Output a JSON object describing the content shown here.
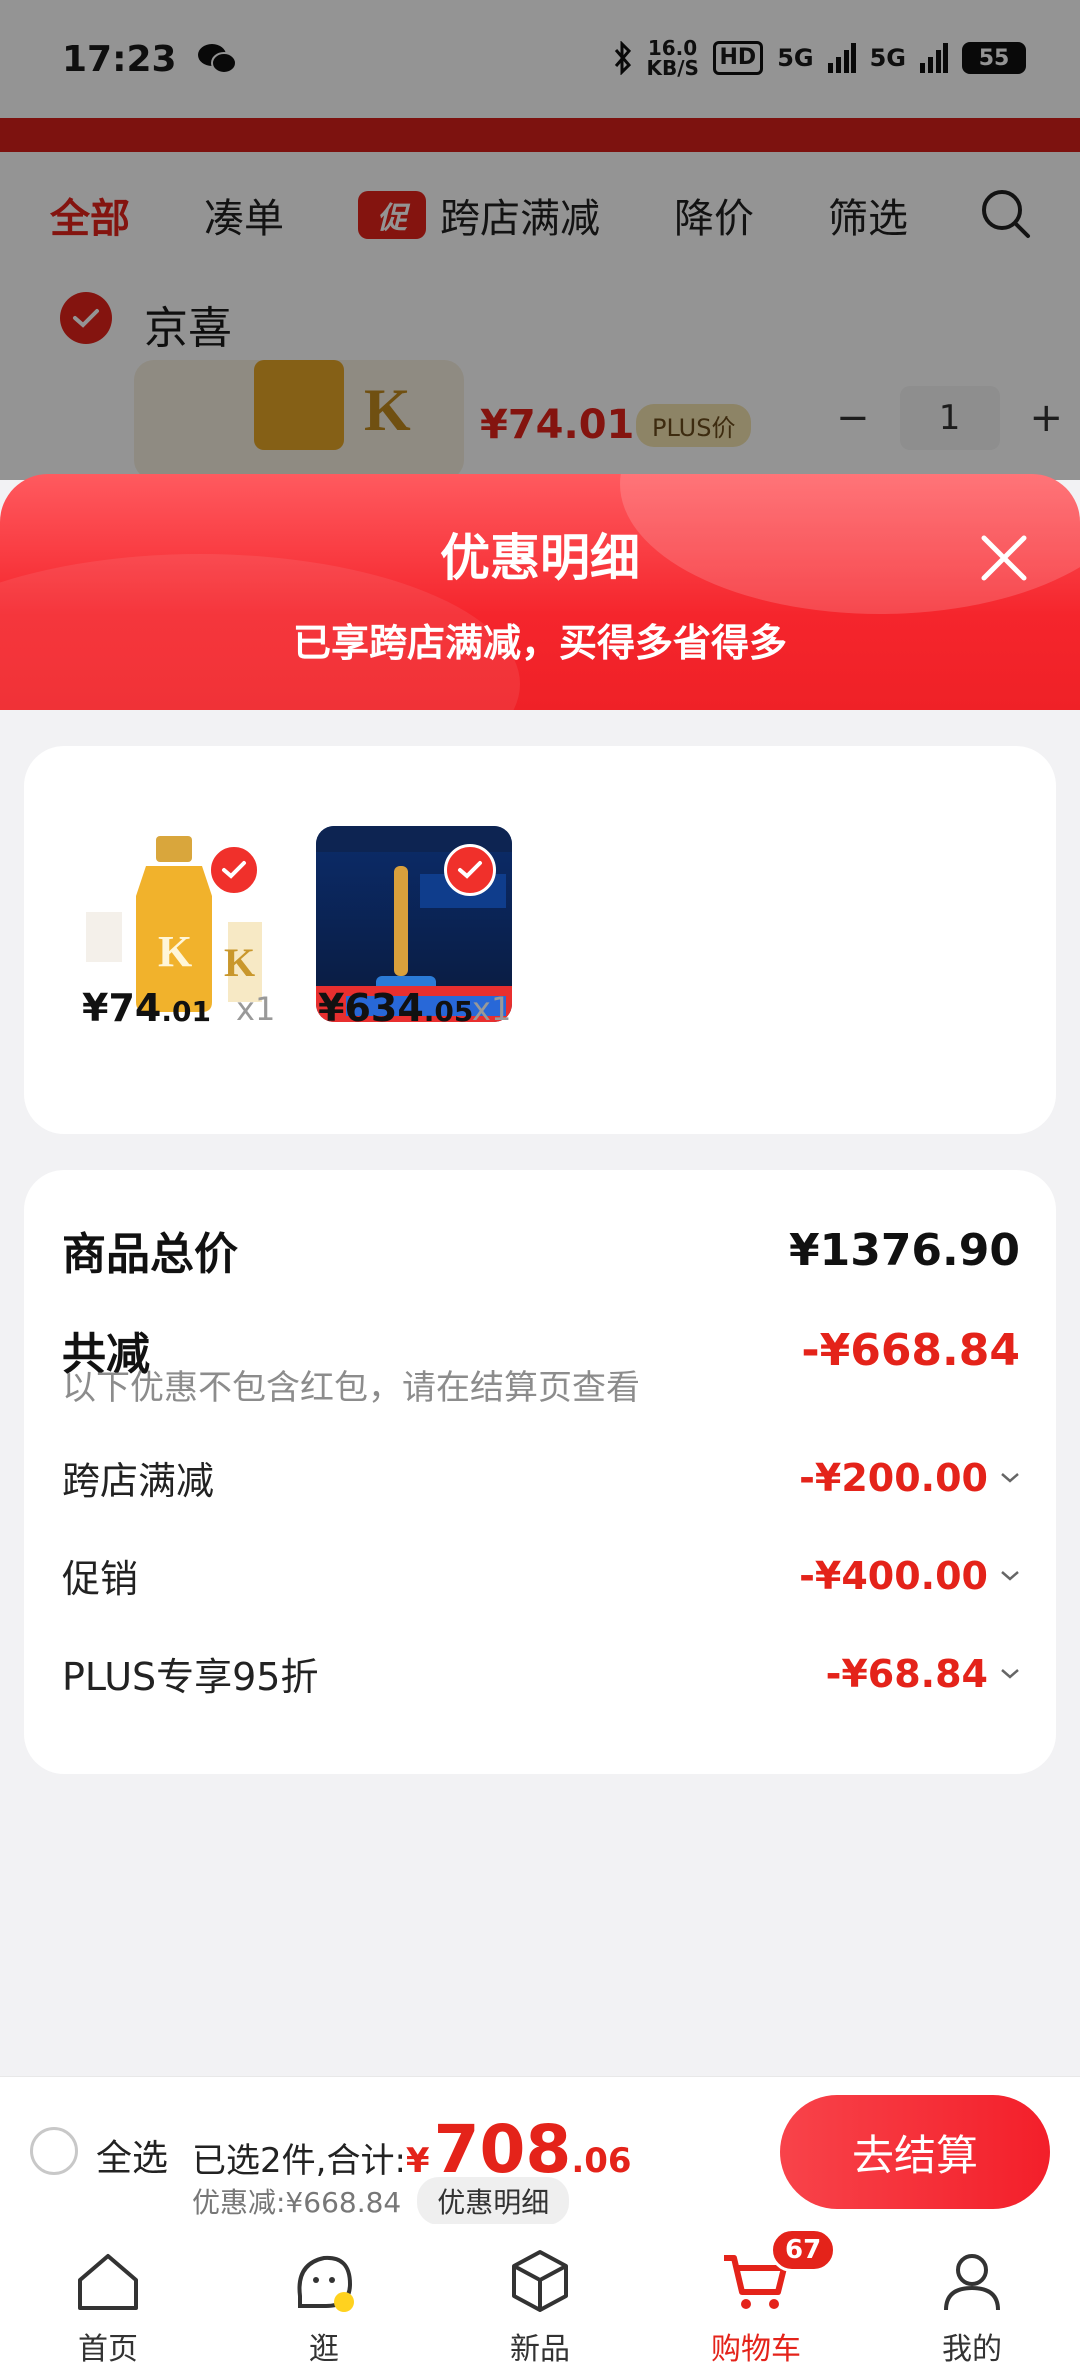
{
  "status_bar": {
    "time": "17:23",
    "net_speed": "16.0 KB/S",
    "hd": "HD",
    "signal_1": "5G",
    "signal_2": "5G",
    "battery": "55"
  },
  "tabs": [
    {
      "label": "全部",
      "active": true
    },
    {
      "label": "凑单",
      "active": false
    },
    {
      "label": "跨店满减",
      "active": false,
      "chip": "促"
    },
    {
      "label": "降价",
      "active": false
    },
    {
      "label": "筛选",
      "active": false
    }
  ],
  "shop": {
    "name": "京喜",
    "price": "¥74.01",
    "plus_tag": "PLUS价",
    "quantity": "1",
    "minus": "−",
    "plus": "+"
  },
  "sheet": {
    "title": "优惠明细",
    "subtitle": "已享跨店满减，买得多省得多"
  },
  "products": [
    {
      "price_int": "¥74",
      "price_dec": ".01",
      "qty": "x1",
      "image": "hair-oil-product"
    },
    {
      "price_int": "¥634",
      "price_dec": ".05",
      "qty": "x1",
      "image": "razor-product"
    }
  ],
  "summary": {
    "total_label": "商品总价",
    "total_value": "¥1376.90",
    "reduce_label": "共减",
    "reduce_value": "-¥668.84",
    "note": "以下优惠不包含红包，请在结算页查看",
    "items": [
      {
        "label": "跨店满减",
        "value": "-¥200.00"
      },
      {
        "label": "促销",
        "value": "-¥400.00"
      },
      {
        "label": "PLUS专享95折",
        "value": "-¥68.84"
      }
    ]
  },
  "checkout": {
    "select_all": "全选",
    "selected_text": "已选2件,合计:",
    "total_currency": "¥",
    "total_int": "708",
    "total_dec": ".06",
    "discount_text": "优惠减:¥668.84",
    "detail_chip": "优惠明细",
    "button": "去结算"
  },
  "nav": [
    {
      "label": "首页",
      "icon": "home-icon"
    },
    {
      "label": "逛",
      "icon": "explore-icon"
    },
    {
      "label": "新品",
      "icon": "new-products-icon"
    },
    {
      "label": "购物车",
      "icon": "cart-icon",
      "active": true,
      "badge": "67"
    },
    {
      "label": "我的",
      "icon": "profile-icon"
    }
  ],
  "colors": {
    "accent": "#e4231a",
    "sheet_red": "#f5252c",
    "background": "#f2f2f4"
  }
}
